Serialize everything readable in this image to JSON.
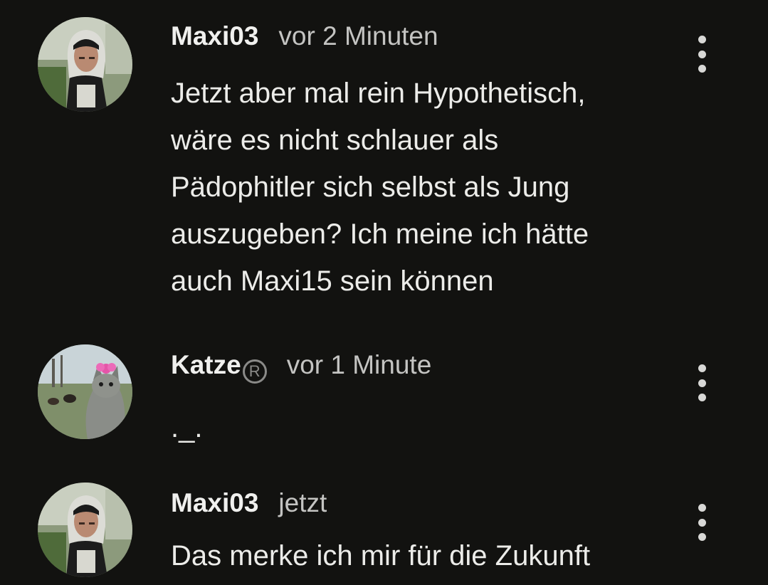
{
  "comments": [
    {
      "username": "Maxi03",
      "badge": "",
      "timestamp": "vor 2 Minuten",
      "lines": [
        "Jetzt aber mal rein Hypothetisch,",
        "wäre es nicht schlauer als",
        "Pädophitler sich selbst als Jung",
        "auszugeben? Ich meine ich hätte",
        "auch Maxi15 sein können"
      ],
      "avatar_icon": "avatar-person-hoodie"
    },
    {
      "username": "Katze",
      "badge": "R",
      "timestamp": "vor 1 Minute",
      "lines": [
        "._."
      ],
      "avatar_icon": "avatar-cat-photo"
    },
    {
      "username": "Maxi03",
      "badge": "",
      "timestamp": "jetzt",
      "lines": [
        "Das merke ich mir für die Zukunft"
      ],
      "avatar_icon": "avatar-person-hoodie"
    }
  ],
  "colors": {
    "background": "#121210",
    "text": "#ecece9",
    "timestamp": "#c4c4c2",
    "badge": "#8a8a88"
  }
}
